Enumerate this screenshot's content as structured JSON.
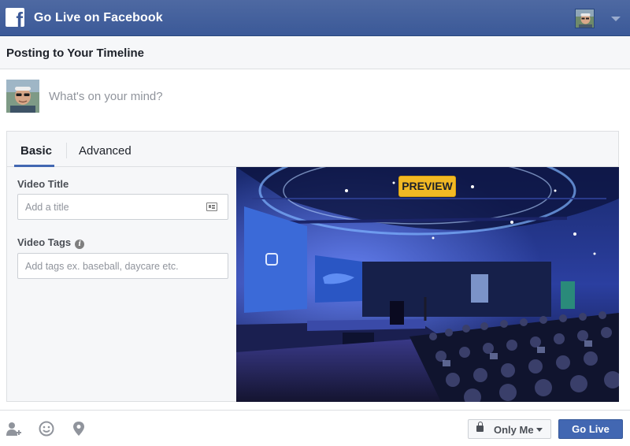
{
  "topbar": {
    "title": "Go Live on Facebook",
    "logo_icon": "facebook-f-icon",
    "avatar_icon": "user-avatar",
    "menu_icon": "chevron-down-icon",
    "bg_color": "#3b5998"
  },
  "header": {
    "title": "Posting to Your Timeline"
  },
  "composer": {
    "placeholder": "What's on your mind?",
    "avatar_icon": "user-avatar"
  },
  "tabs": [
    {
      "label": "Basic",
      "active": true
    },
    {
      "label": "Advanced",
      "active": false
    }
  ],
  "form": {
    "video_title_label": "Video Title",
    "video_title_placeholder": "Add a title",
    "video_tags_label": "Video Tags",
    "video_tags_placeholder": "Add tags ex. baseball, daycare etc.",
    "info_icon": "info-icon",
    "title_field_icon": "id-card-icon"
  },
  "preview": {
    "badge": "PREVIEW",
    "badge_color": "#f2b924"
  },
  "footer": {
    "icons": [
      "tag-people-icon",
      "feeling-smiley-icon",
      "location-pin-icon"
    ],
    "privacy_label": "Only Me",
    "go_live_label": "Go Live",
    "primary_color": "#4267b2"
  }
}
